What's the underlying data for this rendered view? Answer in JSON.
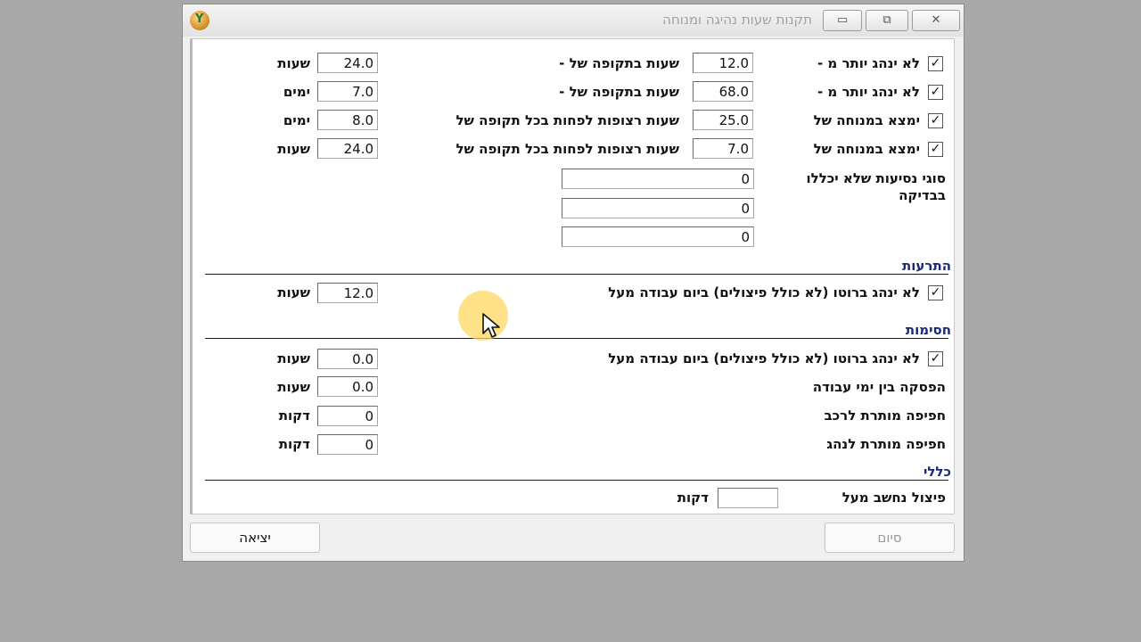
{
  "window": {
    "title": "תקנות שעות נהיגה ומנוחה",
    "app_icon_glyph": "Y",
    "minimize_glyph": "▭",
    "restore_glyph": "⧉",
    "close_glyph": "✕"
  },
  "rules": [
    {
      "checked": "✓",
      "label": "לא ינהג יותר מ -",
      "value": "12.0",
      "mid_label": "שעות בתקופה של -",
      "period_value": "24.0",
      "unit": "שעות"
    },
    {
      "checked": "✓",
      "label": "לא ינהג יותר מ -",
      "value": "68.0",
      "mid_label": "שעות בתקופה של -",
      "period_value": "7.0",
      "unit": "ימים"
    },
    {
      "checked": "✓",
      "label": "ימצא במנוחה של",
      "value": "25.0",
      "mid_label": "שעות רצופות לפחות בכל תקופה של",
      "period_value": "8.0",
      "unit": "ימים"
    },
    {
      "checked": "✓",
      "label": "ימצא במנוחה של",
      "value": "7.0",
      "mid_label": "שעות רצופות לפחות בכל תקופה של",
      "period_value": "24.0",
      "unit": "שעות"
    }
  ],
  "excluded_trips": {
    "label_line1": "סוגי נסיעות שלא יכללו",
    "label_line2": "בבדיקה",
    "values": [
      "0",
      "0",
      "0"
    ]
  },
  "alerts": {
    "title": "התרעות",
    "checked": "✓",
    "label": "לא ינהג ברוטו (לא כולל פיצולים) ביום עבודה מעל",
    "value": "12.0",
    "unit": "שעות"
  },
  "blocks": {
    "title": "חסימות",
    "rows": [
      {
        "checked": "✓",
        "label": "לא ינהג ברוטו (לא כולל פיצולים) ביום עבודה מעל",
        "value": "0.0",
        "unit": "שעות"
      },
      {
        "label": "הפסקה בין ימי עבודה",
        "value": "0.0",
        "unit": "שעות"
      },
      {
        "label": "חפיפה מותרת לרכב",
        "value": "0",
        "unit": "דקות"
      },
      {
        "label": "חפיפה מותרת לנהג",
        "value": "0",
        "unit": "דקות"
      }
    ]
  },
  "general": {
    "title": "כללי",
    "label": "פיצול נחשב מעל",
    "value": "",
    "unit": "דקות"
  },
  "buttons": {
    "finish": "סיום",
    "exit": "יציאה"
  }
}
